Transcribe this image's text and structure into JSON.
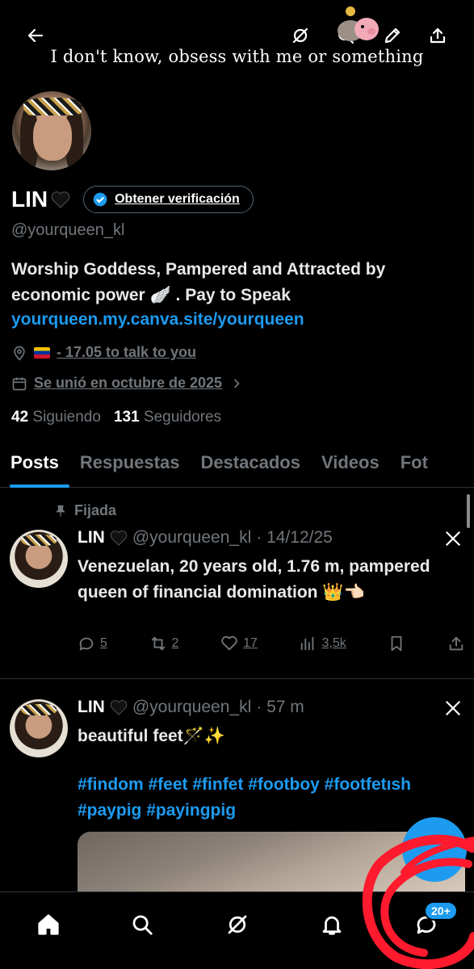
{
  "header": {
    "banner_caption": "I don't know, obsess with me or something",
    "icons": [
      "back-arrow-icon",
      "grok-icon",
      "search-icon",
      "pig-coin-sticker",
      "edit-icon",
      "share-icon"
    ]
  },
  "profile": {
    "name": "LIN",
    "verify_label": "Obtener verificación",
    "handle": "@yourqueen_kl",
    "bio": "Worship Goddess, Pampered and Attracted by economic power 🪽 . Pay to Speak",
    "link": "yourqueen.my.canva.site/yourqueen",
    "location": "- 17.05 to talk to you",
    "joined": "Se unió en octubre de 2025",
    "following_count": "42",
    "following_label": "Siguiendo",
    "followers_count": "131",
    "followers_label": "Seguidores"
  },
  "tabs": [
    "Posts",
    "Respuestas",
    "Destacados",
    "Videos",
    "Fot"
  ],
  "posts": [
    {
      "pinned_label": "Fijada",
      "name": "LIN",
      "handle": "@yourqueen_kl",
      "time": "· 14/12/25",
      "text": "Venezuelan, 20 years old, 1.76 m, pampered queen of financial domination 👑👈🏻",
      "replies": "5",
      "reposts": "2",
      "likes": "17",
      "views": "3,5k"
    },
    {
      "name": "LIN",
      "handle": "@yourqueen_kl",
      "time": "· 57 m",
      "text": "beautiful feet🪄✨",
      "hashtags": "#findom #feet #finfet #footboy #footfetısh #paypig #payingpig"
    }
  ],
  "bottom_nav": {
    "items": [
      "home-icon",
      "search-icon",
      "grok-icon",
      "notifications-icon",
      "messages-icon"
    ],
    "messages_badge": "20+"
  },
  "colors": {
    "accent": "#1d9bf0",
    "muted": "#71767b",
    "background": "#000000",
    "annotation": "#ff1a2e"
  }
}
